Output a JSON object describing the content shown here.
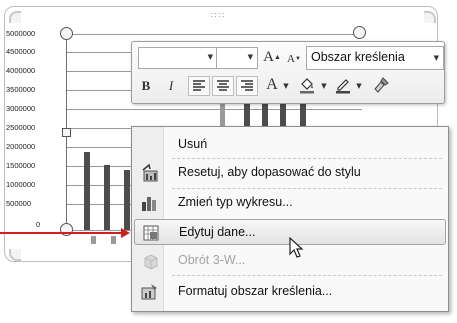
{
  "chart": {
    "y_ticks": [
      "5000000",
      "4500000",
      "4000000",
      "3500000",
      "3000000",
      "2500000",
      "2000000",
      "1500000",
      "1000000",
      "500000",
      "0"
    ]
  },
  "mini_toolbar": {
    "font_name": "",
    "font_size": "",
    "grow_font_icon": "A",
    "shrink_font_icon": "A",
    "element_selector": "Obszar kreślenia",
    "bold_label": "B",
    "italic_label": "I",
    "font_color_icon": "A"
  },
  "context_menu": {
    "items": [
      {
        "label": "Usuń",
        "icon": "none",
        "enabled": true
      },
      {
        "label": "Resetuj, aby dopasować do stylu",
        "icon": "reset-style-icon",
        "enabled": true
      },
      {
        "label": "Zmień typ wykresu...",
        "icon": "chart-type-icon",
        "enabled": true
      },
      {
        "label": "Edytuj dane...",
        "icon": "edit-data-icon",
        "enabled": true
      },
      {
        "label": "Obrót 3-W...",
        "icon": "rotate-3d-icon",
        "enabled": false
      },
      {
        "label": "Formatuj obszar kreślenia...",
        "icon": "format-plot-area-icon",
        "enabled": true
      }
    ]
  },
  "colors": {
    "annotation_arrow": "#d02020",
    "bar_dark": "#4d4d4d",
    "bar_light": "#9a9a9a"
  }
}
